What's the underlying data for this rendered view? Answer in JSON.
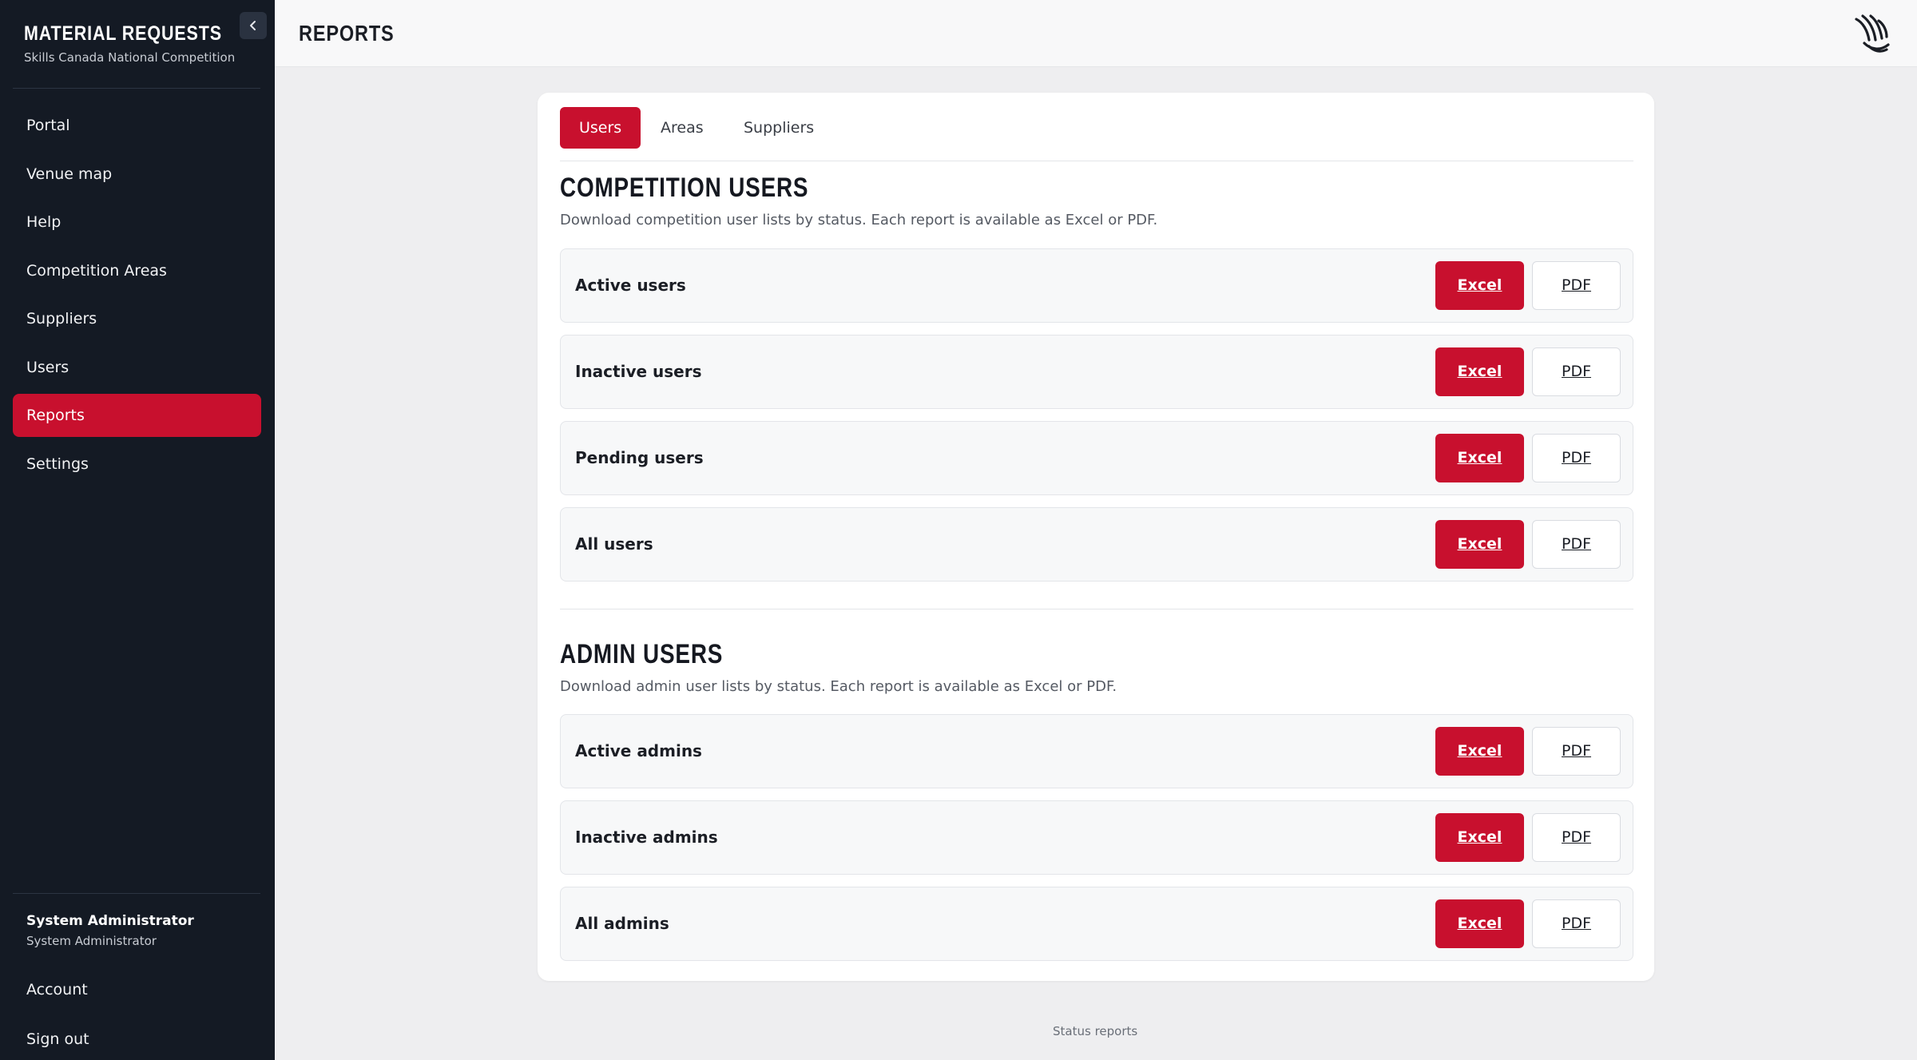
{
  "app": {
    "title": "MATERIAL REQUESTS",
    "subtitle": "Skills Canada National Competition"
  },
  "sidebar": {
    "items": [
      {
        "label": "Portal"
      },
      {
        "label": "Venue map"
      },
      {
        "label": "Help"
      },
      {
        "label": "Competition Areas"
      },
      {
        "label": "Suppliers"
      },
      {
        "label": "Users"
      },
      {
        "label": "Reports",
        "active": true
      },
      {
        "label": "Settings"
      }
    ],
    "user": {
      "name": "System Administrator",
      "role": "System Administrator"
    },
    "account_label": "Account",
    "signout_label": "Sign out"
  },
  "header": {
    "title": "REPORTS"
  },
  "tabs": [
    {
      "label": "Users",
      "active": true
    },
    {
      "label": "Areas"
    },
    {
      "label": "Suppliers"
    }
  ],
  "sections": [
    {
      "title": "COMPETITION USERS",
      "description": "Download competition user lists by status. Each report is available as Excel or PDF.",
      "rows": [
        {
          "label": "Active users",
          "excel": "Excel",
          "pdf": "PDF"
        },
        {
          "label": "Inactive users",
          "excel": "Excel",
          "pdf": "PDF"
        },
        {
          "label": "Pending users",
          "excel": "Excel",
          "pdf": "PDF"
        },
        {
          "label": "All users",
          "excel": "Excel",
          "pdf": "PDF"
        }
      ]
    },
    {
      "title": "ADMIN USERS",
      "description": "Download admin user lists by status. Each report is available as Excel or PDF.",
      "rows": [
        {
          "label": "Active admins",
          "excel": "Excel",
          "pdf": "PDF"
        },
        {
          "label": "Inactive admins",
          "excel": "Excel",
          "pdf": "PDF"
        },
        {
          "label": "All admins",
          "excel": "Excel",
          "pdf": "PDF"
        }
      ]
    }
  ],
  "footer": {
    "note": "Status reports"
  },
  "icons": {
    "collapse": "chevron-left-icon",
    "logo": "brand-logo-icon"
  },
  "colors": {
    "accent": "#c8102e",
    "sidebar": "#141a24"
  }
}
